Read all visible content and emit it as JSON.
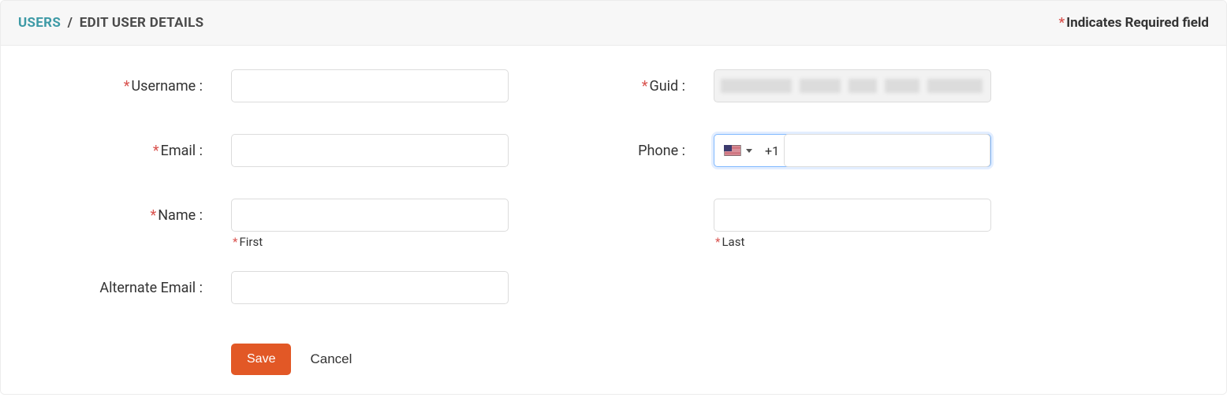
{
  "header": {
    "breadcrumb_root": "USERS",
    "breadcrumb_sep": "/",
    "breadcrumb_current": "EDIT USER DETAILS",
    "required_note_star": "*",
    "required_note": "Indicates Required field"
  },
  "labels": {
    "username": "Username :",
    "email": "Email :",
    "name": "Name :",
    "alt_email": "Alternate Email :",
    "guid": "Guid :",
    "phone": "Phone :",
    "first": "First",
    "last": "Last"
  },
  "values": {
    "username": "",
    "email": "",
    "first_name": "",
    "last_name": "",
    "alt_email": "",
    "guid": "",
    "phone_prefix": "+1",
    "phone_number": "",
    "phone_country": "US"
  },
  "actions": {
    "save": "Save",
    "cancel": "Cancel"
  },
  "marks": {
    "star": "*"
  }
}
